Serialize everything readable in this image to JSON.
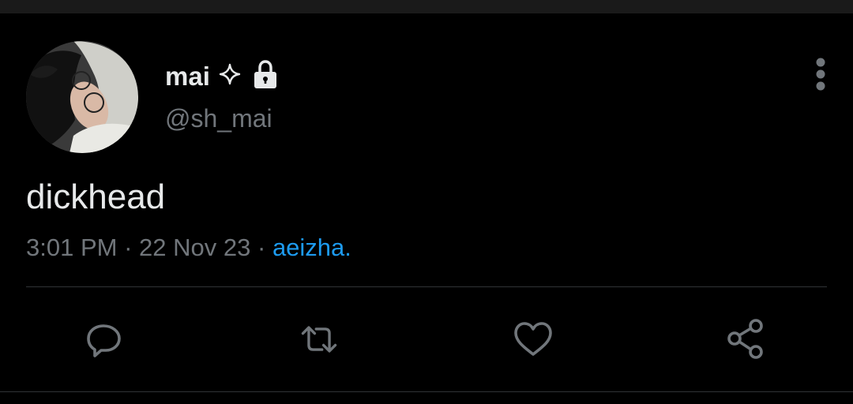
{
  "tweet": {
    "author": {
      "display_name": "mai",
      "handle": "@sh_mai",
      "badge_icon": "sparkle-icon",
      "protected_icon": "lock-icon"
    },
    "text": "dickhead",
    "time": "3:01 PM",
    "separator": "·",
    "date": "22 Nov 23",
    "source": "aeizha.",
    "actions": [
      "reply-icon",
      "retweet-icon",
      "like-icon",
      "share-icon"
    ]
  },
  "colors": {
    "background": "#000000",
    "primary_text": "#e7e9ea",
    "secondary_text": "#71767b",
    "link": "#1d9bf0",
    "divider": "#2f3336"
  }
}
